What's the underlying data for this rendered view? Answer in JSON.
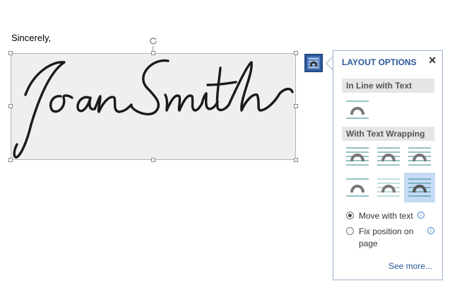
{
  "document": {
    "closing_text": "Sincerely,"
  },
  "signature": {
    "text": "Joan Smith"
  },
  "layout_options": {
    "title": "LAYOUT OPTIONS",
    "close_glyph": "✕",
    "sections": {
      "inline": "In Line with Text",
      "wrapping": "With Text Wrapping"
    },
    "wrapping_options": [
      "square",
      "tight",
      "through",
      "top-and-bottom",
      "behind-text",
      "in-front-of-text"
    ],
    "selected_wrapping": "in-front-of-text",
    "radio": {
      "move_with_text": {
        "label": "Move with text",
        "checked": true
      },
      "fix_position": {
        "label_line1": "Fix position on",
        "label_line2": "page",
        "checked": false
      }
    },
    "info_glyph": "i",
    "see_more": "See more..."
  },
  "colors": {
    "accent": "#2b579a",
    "selected_bg": "#c5daf3",
    "icon_arch": "#777777",
    "icon_line": "#2f8a8a"
  }
}
